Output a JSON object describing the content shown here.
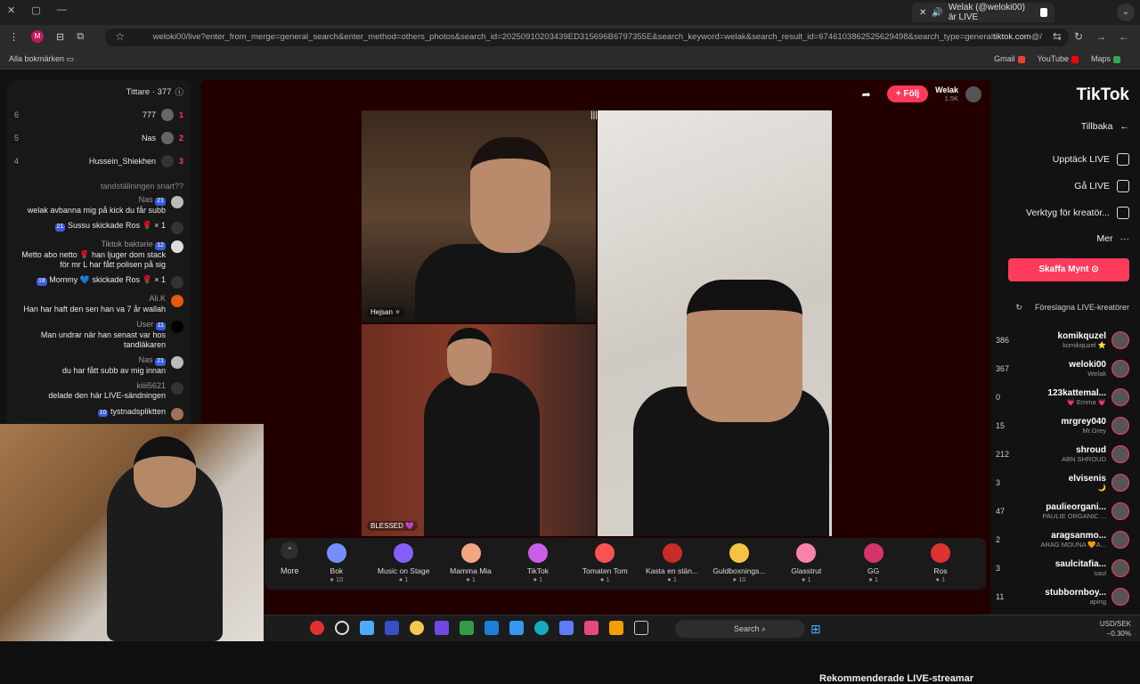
{
  "browser": {
    "tab_title": "Welak (@weloki00) är LIVE",
    "url_host": "tiktok.com",
    "url_rest": "/@weloki00/live?enter_from_merge=general_search&enter_method=others_photos&search_id=20250910203439ED315696B6797355E&search_keyword=welak&search_result_id=6746103862525629498&search_type=general",
    "profile_initial": "M",
    "bookmarks_left": "Alla bokmärken",
    "bookmarks": [
      "Gmail",
      "YouTube",
      "Maps"
    ]
  },
  "chat": {
    "title": "Tittare · 377",
    "ranks": [
      {
        "num": "1",
        "name": "777",
        "score": "6"
      },
      {
        "num": "2",
        "name": "Nas",
        "score": "5"
      },
      {
        "num": "3",
        "name": "Hussein_Shiekhen",
        "score": "4"
      }
    ],
    "question": "tandställningen snart??",
    "messages": [
      {
        "name": "Nas",
        "badge": "21",
        "text": "welak avbanna mig på kick du får subb"
      },
      {
        "name": "",
        "badge": "21",
        "text": "Sussu skickade Ros 🌹 × 1"
      },
      {
        "name": "Tiktok baktərie",
        "badge": "12",
        "text": "Metto abo netto 🌹 han ljuger dom stack för mr L har fått polisen på sig"
      },
      {
        "name": "",
        "badge": "18",
        "text": "Mommy 💙 skickade Ros 🌹 × 1"
      },
      {
        "name": "Ali.K",
        "badge": "",
        "text": "Han har haft den sen han va 7 år wallah"
      },
      {
        "name": "User",
        "badge": "11",
        "text": "Man undrar när han senast var hos tandläkaren"
      },
      {
        "name": "Nas",
        "badge": "21",
        "text": "du har fått subb av mig innan"
      },
      {
        "name": "kiiii5621",
        "badge": "",
        "text": "delade den här LIVE-sändningen"
      },
      {
        "name": "",
        "badge": "10",
        "text": "tystnadspliktten"
      }
    ]
  },
  "stream": {
    "streamer_name": "Welak",
    "streamer_likes": "1.5K",
    "follow_label": "+ Följ",
    "video1_label": "Hejsan ✧",
    "video2_label": "BLESSED 💜"
  },
  "gifts": [
    {
      "name": "Ros",
      "price": "1",
      "color": "#e03131"
    },
    {
      "name": "GG",
      "price": "1",
      "color": "#d6336c"
    },
    {
      "name": "Glasstrut",
      "price": "1",
      "color": "#f783ac"
    },
    {
      "name": "Guldboxnings...",
      "price": "10",
      "color": "#f5c542"
    },
    {
      "name": "Kasta en stän...",
      "price": "1",
      "color": "#c92a2a"
    },
    {
      "name": "Tomaten Tom",
      "price": "1",
      "color": "#fa5252"
    },
    {
      "name": "TikTok",
      "price": "1",
      "color": "#cc5de8"
    },
    {
      "name": "Mamma Mia",
      "price": "1",
      "color": "#f4a582"
    },
    {
      "name": "Music on Stage",
      "price": "1",
      "color": "#845ef7"
    },
    {
      "name": "Bok",
      "price": "10",
      "color": "#748ffc"
    }
  ],
  "gift_more": "More",
  "recs_title": "Rekommenderade LIVE-streamar",
  "sidebar": {
    "logo": "TikTok",
    "nav": [
      "Tillbaka",
      "Upptäck LIVE",
      "Gå LIVE",
      "Verktyg för kreatör...",
      "Mer"
    ],
    "coins_button": "Skaffa Mynt",
    "suggested_heading": "Föreslagna LIVE-kreatörer",
    "creators": [
      {
        "name": "komikquzel",
        "sub": "komikquzel ⭐",
        "count": "386"
      },
      {
        "name": "weloki00",
        "sub": "Welak",
        "count": "367"
      },
      {
        "name": "123kattemal...",
        "sub": "💗 Emma 💗",
        "count": "0"
      },
      {
        "name": "mrgrey040",
        "sub": "Mr.Grey",
        "count": "15"
      },
      {
        "name": "shroud",
        "sub": "ABN SHROUD",
        "count": "212"
      },
      {
        "name": "elvisenis",
        "sub": "🌙",
        "count": "3"
      },
      {
        "name": "paulieorgani...",
        "sub": "PAULIE ORGANIC ...",
        "count": "47"
      },
      {
        "name": "aragsanmo...",
        "sub": "ARAG MOUNA 🧡A...",
        "count": "2"
      },
      {
        "name": "saulcitafia...",
        "sub": "saul",
        "count": "3"
      },
      {
        "name": "stubbornboy...",
        "sub": "aping",
        "count": "11"
      }
    ]
  },
  "taskbar": {
    "search_label": "Search",
    "ticker": "USD/SEK",
    "ticker_change": "−0.30%"
  }
}
